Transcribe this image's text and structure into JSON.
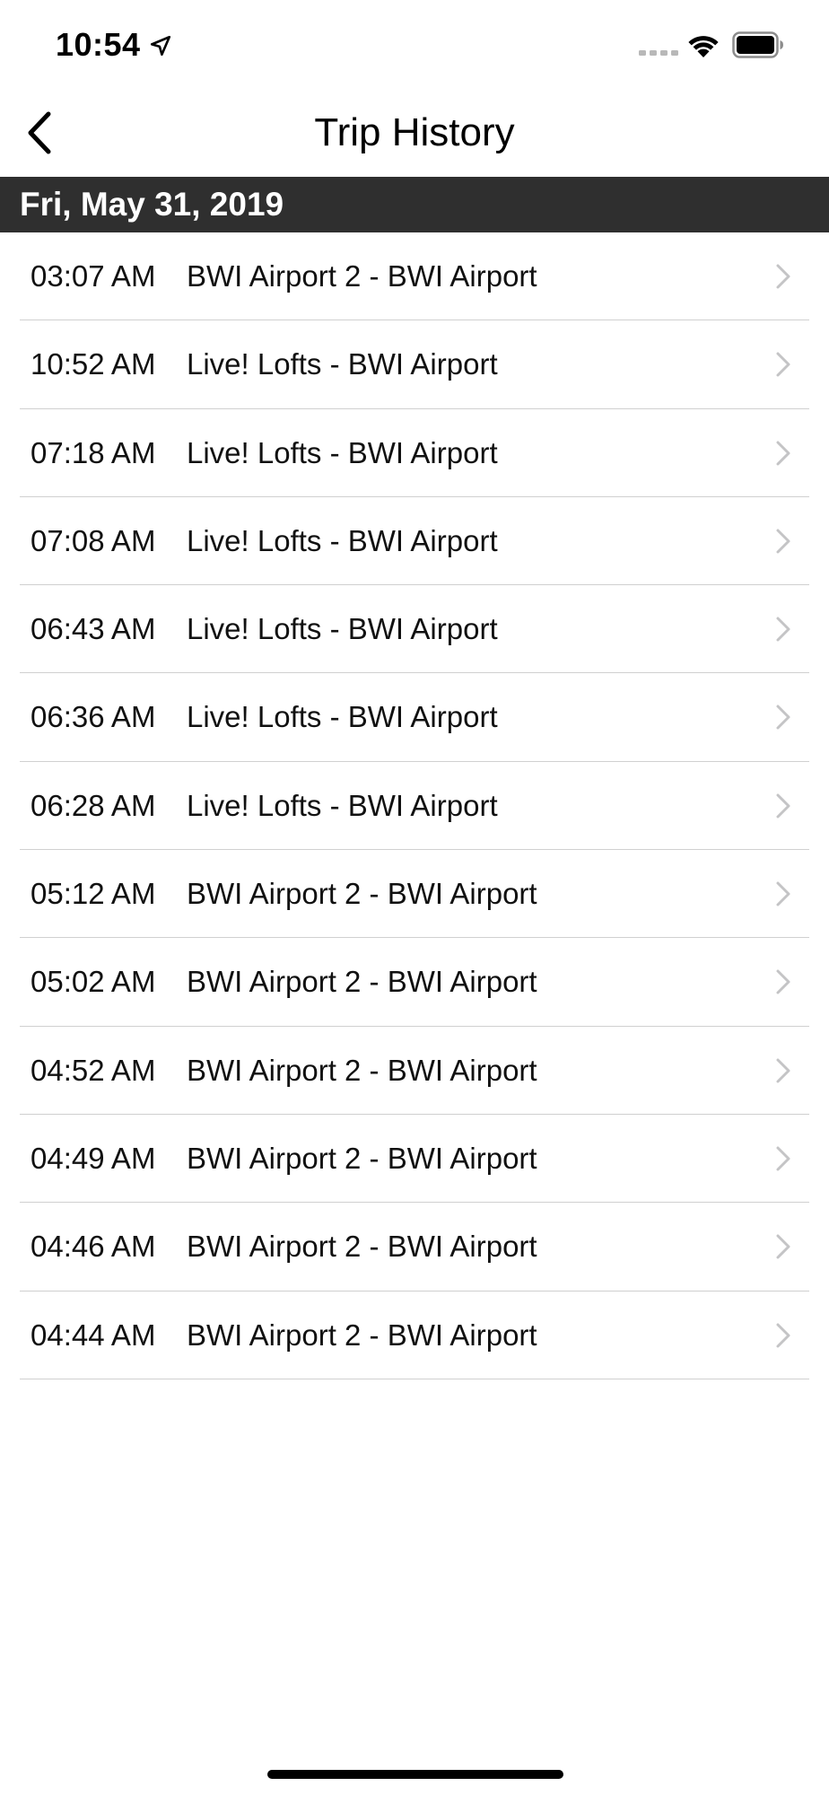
{
  "status_bar": {
    "time": "10:54",
    "icons": [
      "location-arrow-icon",
      "signal-icon",
      "wifi-icon",
      "battery-icon"
    ]
  },
  "nav": {
    "title": "Trip History",
    "back_icon": "chevron-left-icon"
  },
  "section": {
    "date": "Fri, May 31, 2019"
  },
  "trips": [
    {
      "time": "03:07 AM",
      "route": "BWI Airport 2 - BWI Airport"
    },
    {
      "time": "10:52 AM",
      "route": "Live! Lofts - BWI Airport"
    },
    {
      "time": "07:18 AM",
      "route": "Live! Lofts - BWI Airport"
    },
    {
      "time": "07:08 AM",
      "route": "Live! Lofts - BWI Airport"
    },
    {
      "time": "06:43 AM",
      "route": "Live! Lofts - BWI Airport"
    },
    {
      "time": "06:36 AM",
      "route": "Live! Lofts - BWI Airport"
    },
    {
      "time": "06:28 AM",
      "route": "Live! Lofts - BWI Airport"
    },
    {
      "time": "05:12 AM",
      "route": "BWI Airport 2 - BWI Airport"
    },
    {
      "time": "05:02 AM",
      "route": "BWI Airport 2 - BWI Airport"
    },
    {
      "time": "04:52 AM",
      "route": "BWI Airport 2 - BWI Airport"
    },
    {
      "time": "04:49 AM",
      "route": "BWI Airport 2 - BWI Airport"
    },
    {
      "time": "04:46 AM",
      "route": "BWI Airport 2 - BWI Airport"
    },
    {
      "time": "04:44 AM",
      "route": "BWI Airport 2 - BWI Airport"
    }
  ],
  "colors": {
    "section_header_bg": "#2f2f2f",
    "section_header_text": "#ffffff",
    "separator": "#d0d0d0",
    "chevron": "#c4c4c6"
  }
}
